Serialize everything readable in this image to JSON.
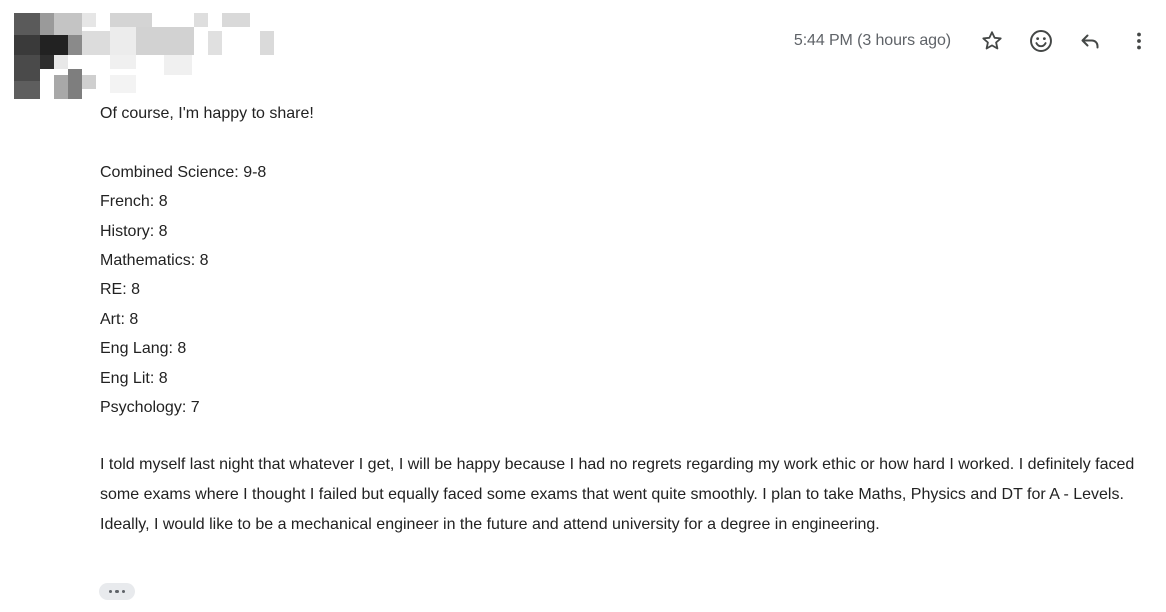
{
  "header": {
    "timestamp": "5:44 PM (3 hours ago)",
    "icons": [
      "star-icon",
      "emoji-reaction-icon",
      "reply-icon",
      "more-options-icon"
    ]
  },
  "message": {
    "greeting": "Of course, I'm happy to share!",
    "grades": [
      "Combined Science: 9-8",
      "French: 8",
      "History: 8",
      "Mathematics: 8",
      "RE: 8",
      "Art: 8",
      "Eng Lang: 8",
      "Eng Lit: 8",
      "Psychology: 7"
    ],
    "closing": "I told myself last night that whatever I get, I will be happy because I had no regrets regarding my work ethic or how hard I worked. I definitely faced some exams where I thought I failed but equally faced some exams that went quite smoothly. I plan to take Maths, Physics and DT for A - Levels. Ideally, I would like to be a mechanical engineer in the future and attend university for a degree in engineering."
  },
  "colors": {
    "text": "#222222",
    "muted": "#5f6368",
    "pill": "#e8eaed"
  }
}
